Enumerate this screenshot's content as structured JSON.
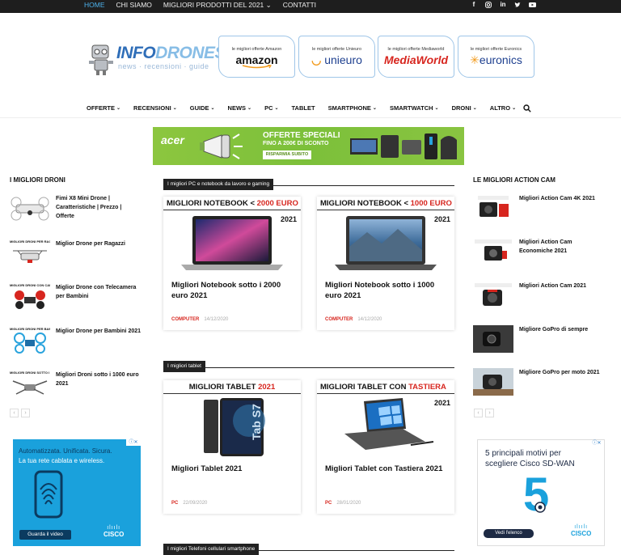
{
  "topbar": {
    "menu": [
      "HOME",
      "CHI SIAMO",
      "MIGLIORI PRODOTTI DEL 2021",
      "CONTATTI"
    ],
    "social_icons": [
      "facebook-icon",
      "instagram-icon",
      "linkedin-icon",
      "twitter-icon",
      "youtube-icon"
    ]
  },
  "logo": {
    "part1": "INFO",
    "part2": "DRONES",
    "tagline": "news · recensioni · guide"
  },
  "promos": [
    {
      "label": "le migliori offerte Amazon",
      "brand": "amazon",
      "color": "#111111"
    },
    {
      "label": "le migliori offerte Unieuro",
      "brand": "unieuro",
      "color": "#1d3f8f"
    },
    {
      "label": "le migliori offerte Mediaworld",
      "brand": "MediaWorld",
      "color": "#d7261f"
    },
    {
      "label": "le migliori offerte Euronics",
      "brand": "euronics",
      "color": "#1d3f8f"
    }
  ],
  "nav": [
    "OFFERTE",
    "RECENSIONI",
    "GUIDE",
    "NEWS",
    "PC",
    "TABLET",
    "SMARTPHONE",
    "SMARTWATCH",
    "DRONI",
    "ALTRO"
  ],
  "banner": {
    "brand": "acer",
    "line1": "OFFERTE SPECIALI",
    "line2": "FINO A 200€ DI SCONTO",
    "button": "RISPARMIA SUBITO"
  },
  "left_sidebar": {
    "title": "I MIGLIORI DRONI",
    "items": [
      "Fimi X8 Mini Drone | Caratteristiche | Prezzo | Offerte",
      "Miglior Drone per Ragazzi",
      "Miglior Drone con Telecamera per Bambini",
      "Miglior Drone per Bambini 2021",
      "Migliori Droni sotto i 1000 euro 2021"
    ],
    "thumb_labels": [
      "",
      "MIGLIORI DRONI PER RAGAZZI",
      "MIGLIORI DRONI CON CAMERA",
      "MIGLIORI DRONI PER BAMBINI",
      "MIGLIORI DRONI SOTTO I 1000 EURO"
    ]
  },
  "right_sidebar": {
    "title": "LE MIGLIORI ACTION CAM",
    "items": [
      "Migliori Action Cam 4K 2021",
      "Migliori Action Cam Economiche 2021",
      "Migliori Action Cam 2021",
      "Migliore GoPro di sempre",
      "Migliore GoPro per moto 2021"
    ]
  },
  "sections": {
    "pc": "I migliori PC e notebook da lavoro e gaming",
    "tablet": "I migliori tablet",
    "phones": "I migliori Telefoni cellulari smartphone"
  },
  "cards": [
    {
      "hdr_black": "MIGLIORI NOTEBOOK < ",
      "hdr_red": "2000 EURO",
      "year": "2021",
      "title": "Migliori Notebook sotto i 2000 euro 2021",
      "cat": "COMPUTER",
      "date": "14/12/2020"
    },
    {
      "hdr_black": "MIGLIORI NOTEBOOK < ",
      "hdr_red": "1000 EURO",
      "year": "2021",
      "title": "Migliori Notebook sotto i 1000 euro 2021",
      "cat": "COMPUTER",
      "date": "14/12/2020"
    },
    {
      "hdr_black": "MIGLIORI TABLET ",
      "hdr_red": "2021",
      "year": "",
      "title": "Migliori Tablet 2021",
      "cat": "PC",
      "date": "22/09/2020"
    },
    {
      "hdr_black": "MIGLIORI TABLET CON ",
      "hdr_red": "TASTIERA",
      "year": "2021",
      "title": "Migliori Tablet con Tastiera 2021",
      "cat": "PC",
      "date": "28/01/2020"
    }
  ],
  "ads": {
    "left": {
      "line1": "Automatizzata. Unificata. Sicura.",
      "line2": "La tua rete cablata e wireless.",
      "button": "Guarda il video",
      "brand": "CISCO"
    },
    "right": {
      "line1": "5 principali motivi per scegliere Cisco SD-WAN",
      "button": "Vedi l'elenco",
      "brand": "CISCO",
      "big": "5"
    }
  },
  "colors": {
    "accent_red": "#d7261f",
    "banner_green": "#8cc63f",
    "ad_blue": "#1aa1dc"
  }
}
